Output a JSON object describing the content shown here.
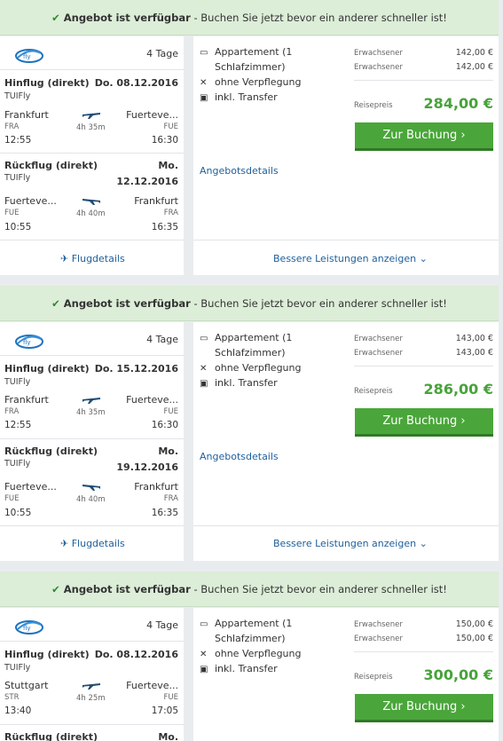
{
  "offers": [
    {
      "banner": {
        "strong": "Angebot ist verfügbar",
        "rest": " - Buchen Sie jetzt bevor ein anderer schneller ist!"
      },
      "days": "4 Tage",
      "outbound": {
        "title": "Hinflug (direkt)",
        "date": "Do. 08.12.2016",
        "airline": "TUIFly",
        "from_city": "Frankfurt",
        "from_code": "FRA",
        "dep": "12:55",
        "duration": "4h 35m",
        "to_city": "Fuerteve...",
        "to_code": "FUE",
        "arr": "16:30"
      },
      "inbound": {
        "title": "Rückflug (direkt)",
        "date_day": "Mo.",
        "date": "12.12.2016",
        "airline": "TUIFly",
        "from_city": "Fuerteve...",
        "from_code": "FUE",
        "dep": "10:55",
        "duration": "4h 40m",
        "to_city": "Frankfurt",
        "to_code": "FRA",
        "arr": "16:35"
      },
      "room1": "Appartement (1",
      "room2": "Schlafzimmer)",
      "board": "ohne Verpflegung",
      "transfer": "inkl. Transfer",
      "adult_label": "Erwachsener",
      "adult1": "142,00 €",
      "adult2": "142,00 €",
      "price_label": "Reisepreis",
      "price": "284,00 €",
      "book": "Zur Buchung",
      "details": "Angebotsdetails",
      "flight_details": "Flugdetails",
      "better": "Bessere Leistungen anzeigen"
    },
    {
      "banner": {
        "strong": "Angebot ist verfügbar",
        "rest": " - Buchen Sie jetzt bevor ein anderer schneller ist!"
      },
      "days": "4 Tage",
      "outbound": {
        "title": "Hinflug (direkt)",
        "date": "Do. 15.12.2016",
        "airline": "TUIFly",
        "from_city": "Frankfurt",
        "from_code": "FRA",
        "dep": "12:55",
        "duration": "4h 35m",
        "to_city": "Fuerteve...",
        "to_code": "FUE",
        "arr": "16:30"
      },
      "inbound": {
        "title": "Rückflug (direkt)",
        "date_day": "Mo.",
        "date": "19.12.2016",
        "airline": "TUIFly",
        "from_city": "Fuerteve...",
        "from_code": "FUE",
        "dep": "10:55",
        "duration": "4h 40m",
        "to_city": "Frankfurt",
        "to_code": "FRA",
        "arr": "16:35"
      },
      "room1": "Appartement (1",
      "room2": "Schlafzimmer)",
      "board": "ohne Verpflegung",
      "transfer": "inkl. Transfer",
      "adult_label": "Erwachsener",
      "adult1": "143,00 €",
      "adult2": "143,00 €",
      "price_label": "Reisepreis",
      "price": "286,00 €",
      "book": "Zur Buchung",
      "details": "Angebotsdetails",
      "flight_details": "Flugdetails",
      "better": "Bessere Leistungen anzeigen"
    },
    {
      "banner": {
        "strong": "Angebot ist verfügbar",
        "rest": " - Buchen Sie jetzt bevor ein anderer schneller ist!"
      },
      "days": "4 Tage",
      "outbound": {
        "title": "Hinflug (direkt)",
        "date": "Do. 08.12.2016",
        "airline": "TUIFly",
        "from_city": "Stuttgart",
        "from_code": "STR",
        "dep": "13:40",
        "duration": "4h 25m",
        "to_city": "Fuerteve...",
        "to_code": "FUE",
        "arr": "17:05"
      },
      "inbound": {
        "title": "Rückflug (direkt)",
        "date_day": "Mo."
      },
      "room1": "Appartement (1",
      "room2": "Schlafzimmer)",
      "board": "ohne Verpflegung",
      "transfer": "inkl. Transfer",
      "adult_label": "Erwachsener",
      "adult1": "150,00 €",
      "adult2": "150,00 €",
      "price_label": "Reisepreis",
      "price": "300,00 €",
      "book": "Zur Buchung"
    }
  ],
  "colors": {
    "banner_bg": "#dcedd8",
    "accent_green": "#4aa63a",
    "price_green": "#47a23a",
    "link_blue": "#1d5f9b"
  }
}
